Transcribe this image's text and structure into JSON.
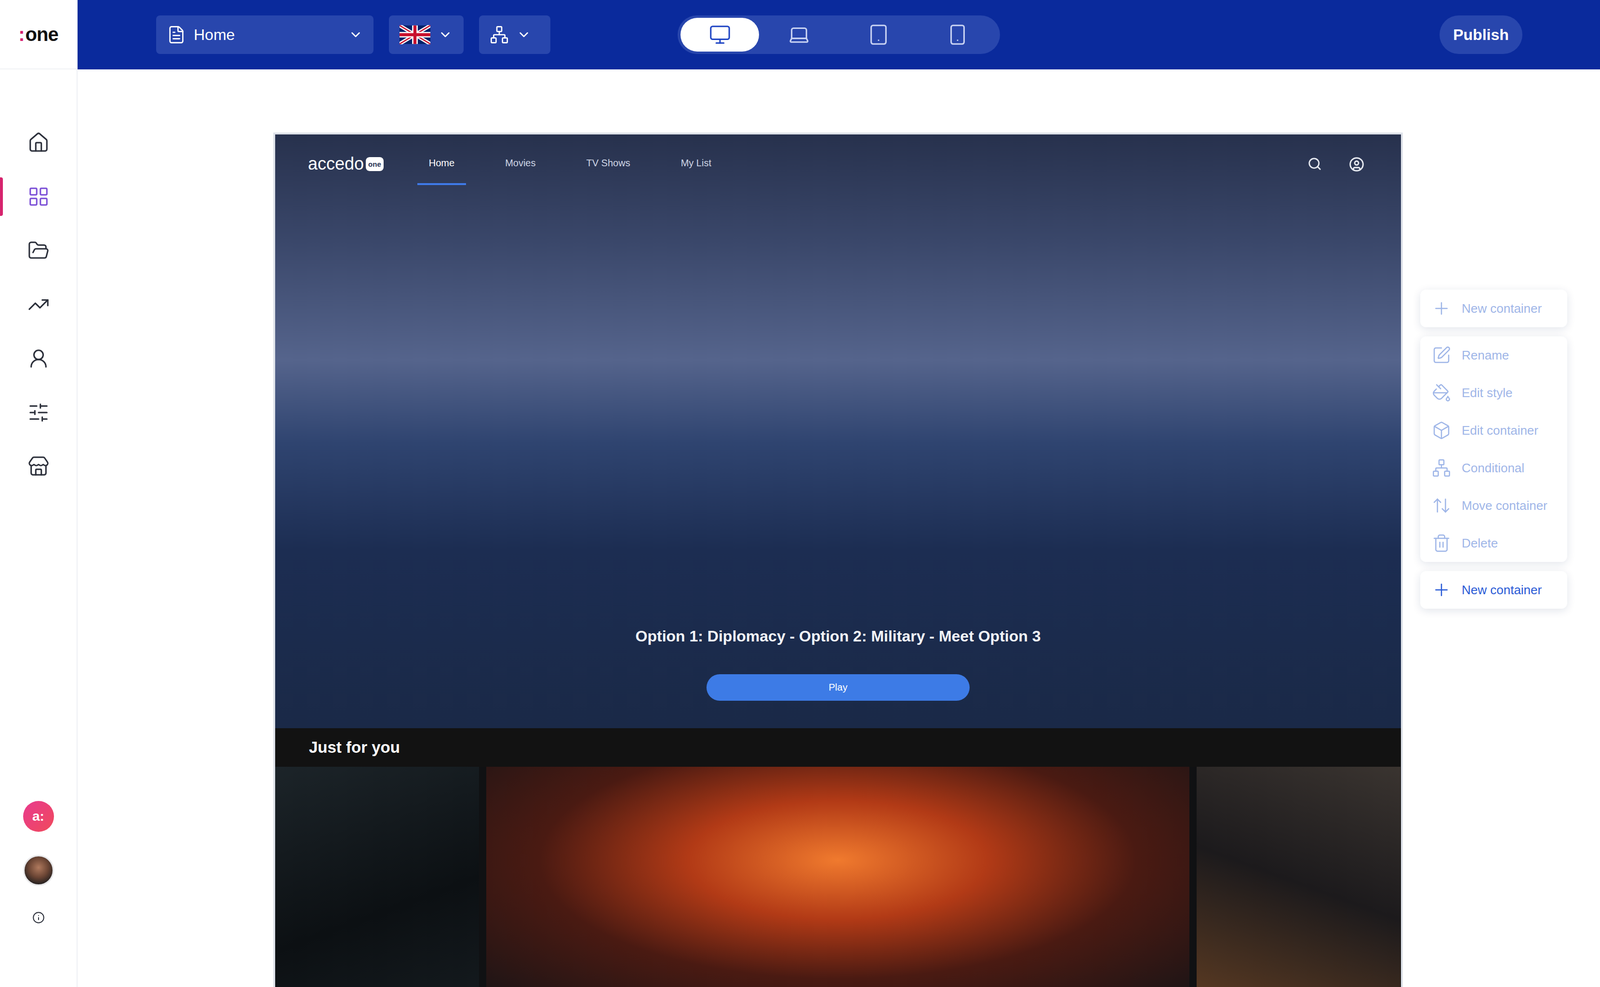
{
  "sidebar": {
    "logo": {
      "mark": ":",
      "word": "one"
    },
    "items": [
      {
        "selected": false
      },
      {
        "selected": true
      },
      {
        "selected": false
      },
      {
        "selected": false
      },
      {
        "selected": false
      },
      {
        "selected": false
      },
      {
        "selected": false
      }
    ],
    "assistant_badge": "a:"
  },
  "topbar": {
    "page_select": "Home",
    "devices": [
      {
        "selected": true
      },
      {
        "selected": false
      },
      {
        "selected": false
      },
      {
        "selected": false
      }
    ],
    "publish": "Publish"
  },
  "preview": {
    "brand": "accedo",
    "brand_badge": "one",
    "nav": [
      {
        "label": "Home",
        "selected": true
      },
      {
        "label": "Movies",
        "selected": false
      },
      {
        "label": "TV Shows",
        "selected": false
      },
      {
        "label": "My List",
        "selected": false
      }
    ],
    "hero": {
      "subtitle": "Option 1: Diplomacy - Option 2: Military - Meet Option 3",
      "play": "Play"
    },
    "rail": {
      "title": "Just for you"
    }
  },
  "menu": {
    "groups": [
      [
        {
          "label": "New container",
          "disabled": true
        }
      ],
      [
        {
          "label": "Rename",
          "disabled": true
        },
        {
          "label": "Edit style",
          "disabled": true
        },
        {
          "label": "Edit container",
          "disabled": true
        },
        {
          "label": "Conditional",
          "disabled": true
        },
        {
          "label": "Move container",
          "disabled": true
        },
        {
          "label": "Delete",
          "disabled": true
        }
      ],
      [
        {
          "label": "New container",
          "disabled": false
        }
      ]
    ]
  }
}
